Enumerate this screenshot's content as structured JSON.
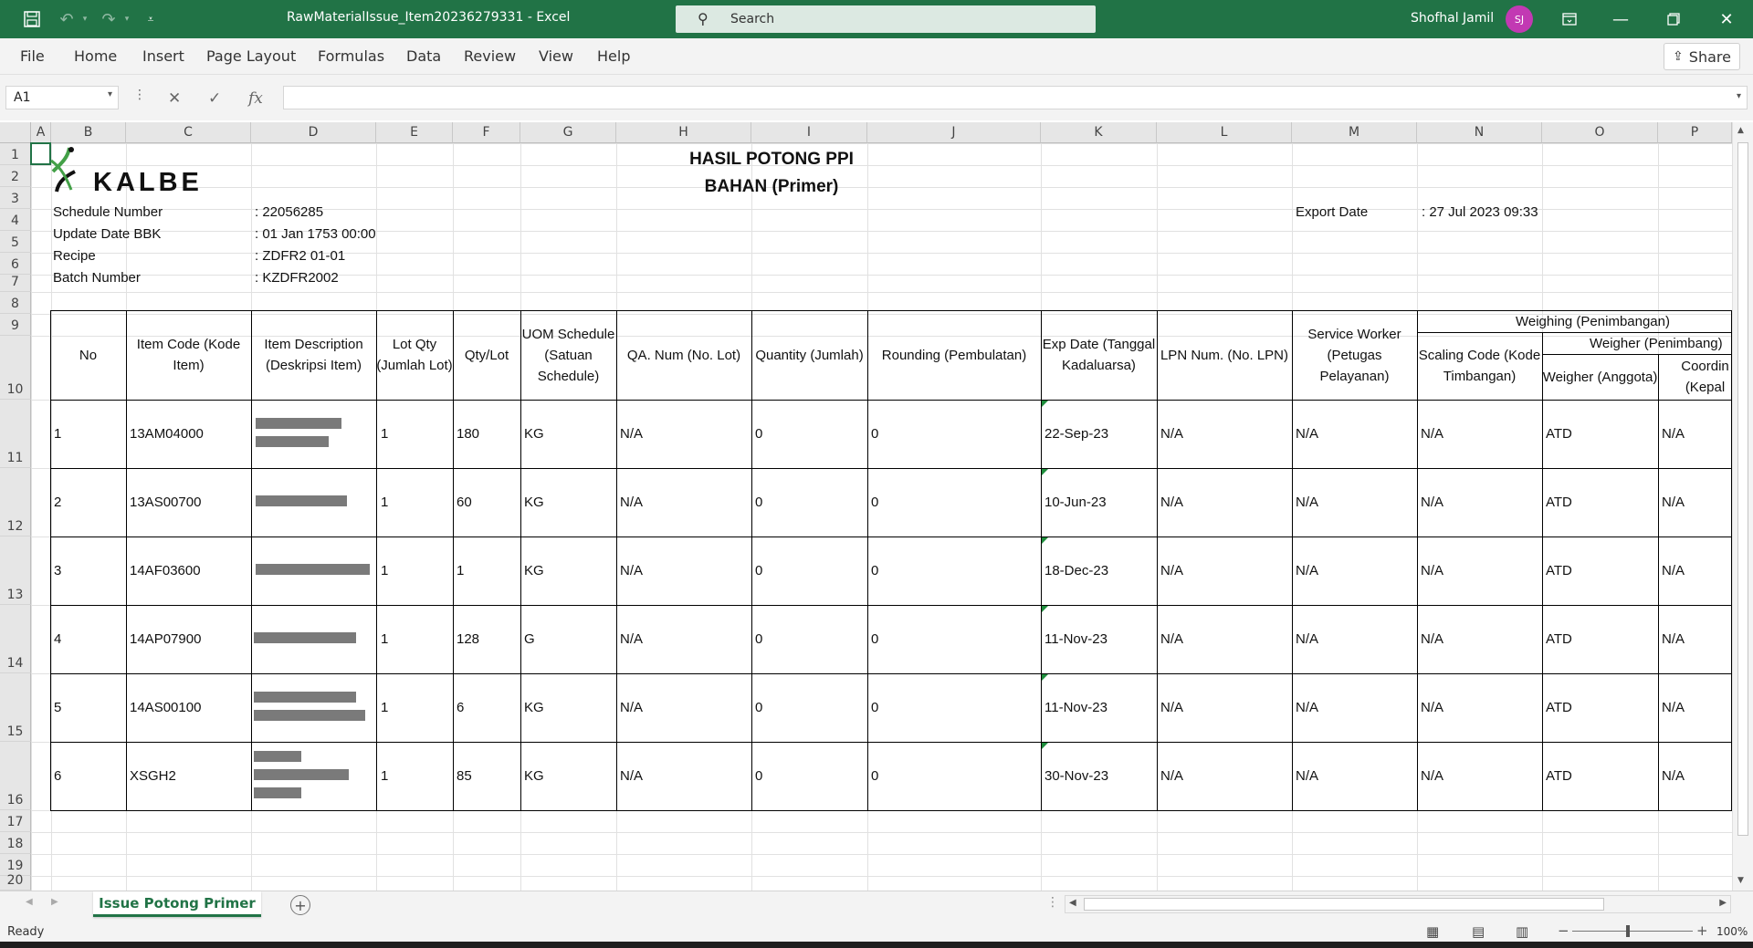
{
  "window": {
    "title": "RawMaterialIssue_Item20236279331  -  Excel",
    "search_placeholder": "Search",
    "user_name": "Shofhal Jamil",
    "user_initials": "SJ"
  },
  "menu": {
    "items": [
      "File",
      "Home",
      "Insert",
      "Page Layout",
      "Formulas",
      "Data",
      "Review",
      "View",
      "Help"
    ],
    "share_label": "Share"
  },
  "formula_bar": {
    "name_box": "A1",
    "fx_label": "fx",
    "formula": ""
  },
  "columns": [
    "A",
    "B",
    "C",
    "D",
    "E",
    "F",
    "G",
    "H",
    "I",
    "J",
    "K",
    "L",
    "M",
    "N",
    "O",
    "P"
  ],
  "rows": [
    "1",
    "2",
    "3",
    "4",
    "5",
    "6",
    "7",
    "8",
    "9",
    "10",
    "11",
    "12",
    "13",
    "14",
    "15",
    "16",
    "17",
    "18",
    "19",
    "20"
  ],
  "sheet": {
    "logo_text": "KALBE",
    "title1": "HASIL POTONG PPI",
    "title2": "BAHAN (Primer)",
    "meta": [
      {
        "label": "Schedule Number",
        "value": ": 22056285"
      },
      {
        "label": "Update Date BBK",
        "value": ": 01 Jan 1753 00:00"
      },
      {
        "label": "Recipe",
        "value": ": ZDFR2 01-01"
      },
      {
        "label": "Batch Number",
        "value": ": KZDFR2002"
      }
    ],
    "export_label": "Export Date",
    "export_value": ": 27 Jul 2023 09:33",
    "headers": {
      "no": "No",
      "item_code": "Item Code (Kode Item)",
      "item_desc": "Item Description (Deskripsi Item)",
      "lot_qty": "Lot Qty (Jumlah Lot)",
      "qty_lot": "Qty/Lot",
      "uom": "UOM Schedule (Satuan Schedule)",
      "qa_num": "QA. Num (No. Lot)",
      "quantity": "Quantity (Jumlah)",
      "rounding": "Rounding (Pembulatan)",
      "exp_date": "Exp Date (Tanggal Kadaluarsa)",
      "lpn": "LPN Num. (No. LPN)",
      "service_worker": "Service Worker (Petugas Pelayanan)",
      "weighing": "Weighing (Penimbangan)",
      "scaling_code": "Scaling Code (Kode Timbangan)",
      "weigher_group": "Weigher (Penimbang)",
      "weigher": "Weigher (Anggota)",
      "coordinator": "Coordin (Kepal"
    },
    "data_rows": [
      {
        "no": "1",
        "code": "13AM04000",
        "lot": "1",
        "qty": "180",
        "uom": "KG",
        "qa": "N/A",
        "quantity": "0",
        "rounding": "0",
        "exp": "22-Sep-23",
        "lpn": "N/A",
        "sw": "N/A",
        "scale": "N/A",
        "weigher": "ATD",
        "coord": "N/A"
      },
      {
        "no": "2",
        "code": "13AS00700",
        "lot": "1",
        "qty": "60",
        "uom": "KG",
        "qa": "N/A",
        "quantity": "0",
        "rounding": "0",
        "exp": "10-Jun-23",
        "lpn": "N/A",
        "sw": "N/A",
        "scale": "N/A",
        "weigher": "ATD",
        "coord": "N/A"
      },
      {
        "no": "3",
        "code": "14AF03600",
        "lot": "1",
        "qty": "1",
        "uom": "KG",
        "qa": "N/A",
        "quantity": "0",
        "rounding": "0",
        "exp": "18-Dec-23",
        "lpn": "N/A",
        "sw": "N/A",
        "scale": "N/A",
        "weigher": "ATD",
        "coord": "N/A"
      },
      {
        "no": "4",
        "code": "14AP07900",
        "lot": "1",
        "qty": "128",
        "uom": "G",
        "qa": "N/A",
        "quantity": "0",
        "rounding": "0",
        "exp": "11-Nov-23",
        "lpn": "N/A",
        "sw": "N/A",
        "scale": "N/A",
        "weigher": "ATD",
        "coord": "N/A"
      },
      {
        "no": "5",
        "code": "14AS00100",
        "lot": "1",
        "qty": "6",
        "uom": "KG",
        "qa": "N/A",
        "quantity": "0",
        "rounding": "0",
        "exp": "11-Nov-23",
        "lpn": "N/A",
        "sw": "N/A",
        "scale": "N/A",
        "weigher": "ATD",
        "coord": "N/A"
      },
      {
        "no": "6",
        "code": "XSGH2",
        "lot": "1",
        "qty": "85",
        "uom": "KG",
        "qa": "N/A",
        "quantity": "0",
        "rounding": "0",
        "exp": "30-Nov-23",
        "lpn": "N/A",
        "sw": "N/A",
        "scale": "N/A",
        "weigher": "ATD",
        "coord": "N/A"
      }
    ]
  },
  "sheet_tabs": {
    "active": "Issue Potong Primer"
  },
  "status": {
    "ready": "Ready",
    "zoom": "100%"
  },
  "colors": {
    "excel_green": "#217346",
    "avatar": "#c239b3"
  }
}
